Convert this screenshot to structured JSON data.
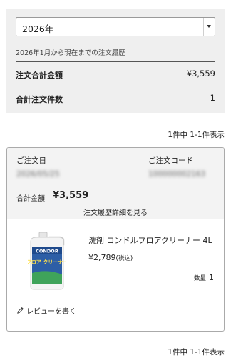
{
  "filter": {
    "year_selected": "2026年",
    "history_note": "2026年1月から現在までの注文履歴"
  },
  "summary": {
    "total_amount_label": "注文合計金額",
    "total_amount_value": "¥3,559",
    "total_orders_label": "合計注文件数",
    "total_orders_value": "1"
  },
  "pager": {
    "text": "1件中 1-1件表示"
  },
  "order": {
    "date_label": "ご注文日",
    "date_value": "2026/05/25",
    "code_label": "ご注文コード",
    "code_value": "100000002163",
    "total_label": "合計金額",
    "total_value": "¥3,559",
    "detail_link": "注文履歴詳細を見る",
    "item": {
      "name": "洗剤 コンドルフロアクリーナー 4L",
      "price": "¥2,789",
      "tax_note": "(税込)",
      "qty_label": "数量",
      "qty_value": "1",
      "image_brand": "CONDOR",
      "image_label": "フロア クリーナー"
    },
    "review_button": "レビューを書く"
  },
  "icons": {
    "dropdown": "chevron-down-icon",
    "review": "pencil-icon"
  },
  "colors": {
    "panel_bg": "#efefef",
    "card_header_bg": "#f3f3f3",
    "bottle_label": "#2d5ea6"
  }
}
